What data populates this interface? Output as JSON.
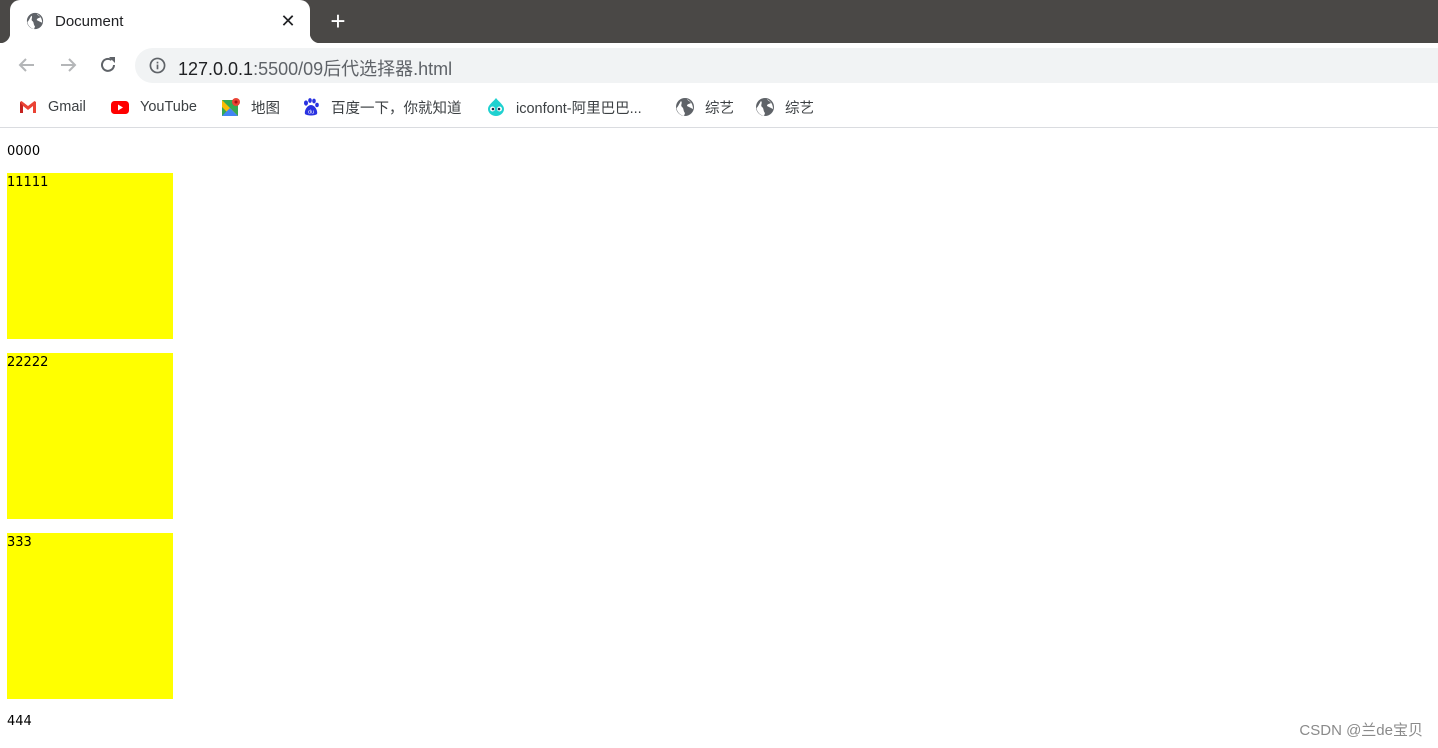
{
  "browser": {
    "tab": {
      "title": "Document",
      "favicon": "globe-icon"
    },
    "new_tab_label": "+",
    "close_label": "✕",
    "address": {
      "host": "127.0.0.1",
      "path": ":5500/09后代选择器.html"
    }
  },
  "bookmarks": [
    {
      "label": "Gmail",
      "icon": "gmail-icon"
    },
    {
      "label": "YouTube",
      "icon": "youtube-icon"
    },
    {
      "label": "地图",
      "icon": "maps-icon"
    },
    {
      "label": "百度一下，你就知道",
      "icon": "baidu-icon"
    },
    {
      "label": "iconfont-阿里巴巴...",
      "icon": "iconfont-icon"
    },
    {
      "label": "综艺",
      "icon": "globe-icon"
    },
    {
      "label": "综艺",
      "icon": "globe-icon"
    }
  ],
  "page": {
    "paragraph_top": "0000",
    "boxes": [
      "11111",
      "22222",
      "333"
    ],
    "paragraph_bottom": "444",
    "box_color": "#ffff00"
  },
  "watermark": "CSDN @兰de宝贝"
}
